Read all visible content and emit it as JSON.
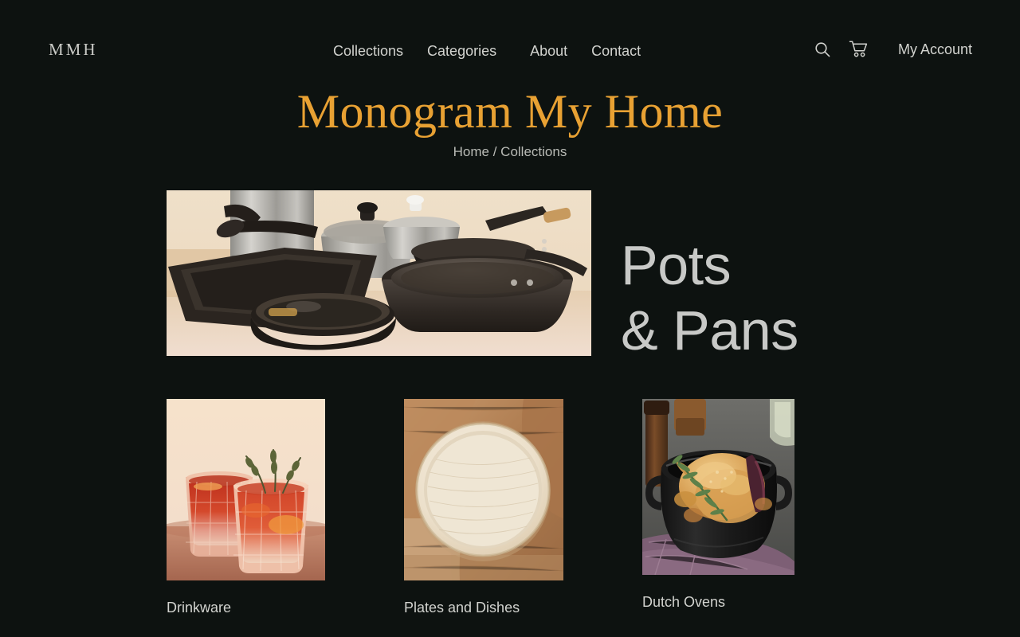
{
  "site": {
    "background_color": "#0d1210",
    "accent_color": "#e8a133",
    "text_color": "#d2d3cf"
  },
  "header": {
    "logo": "MMH",
    "nav": [
      {
        "label": "Collections"
      },
      {
        "label": "Categories"
      },
      {
        "label": "About"
      },
      {
        "label": "Contact"
      }
    ],
    "search_icon": "search-icon",
    "cart_icon": "shopping-cart-icon",
    "account_label": "My Account"
  },
  "brand": {
    "title": "Monogram My Home"
  },
  "breadcrumb": {
    "text": "Home / Collections",
    "items": [
      "Home",
      "Collections"
    ],
    "separator": "/"
  },
  "hero": {
    "title_line_1": "Pots",
    "title_line_2": "& Pans",
    "image_alt": "assorted black skillets, grill pan and stainless steel pots on a light wooden table"
  },
  "collections": [
    {
      "label": "Drinkware",
      "image_alt": "two cut-crystal tumblers with red cocktails and thyme sprigs on a cream background"
    },
    {
      "label": "Plates and Dishes",
      "image_alt": "pale wooden plate photographed from above on wooden boards"
    },
    {
      "label": "Dutch Ovens",
      "image_alt": "black cast-iron dutch oven with roast chicken and rosemary, pepper mills behind"
    }
  ]
}
